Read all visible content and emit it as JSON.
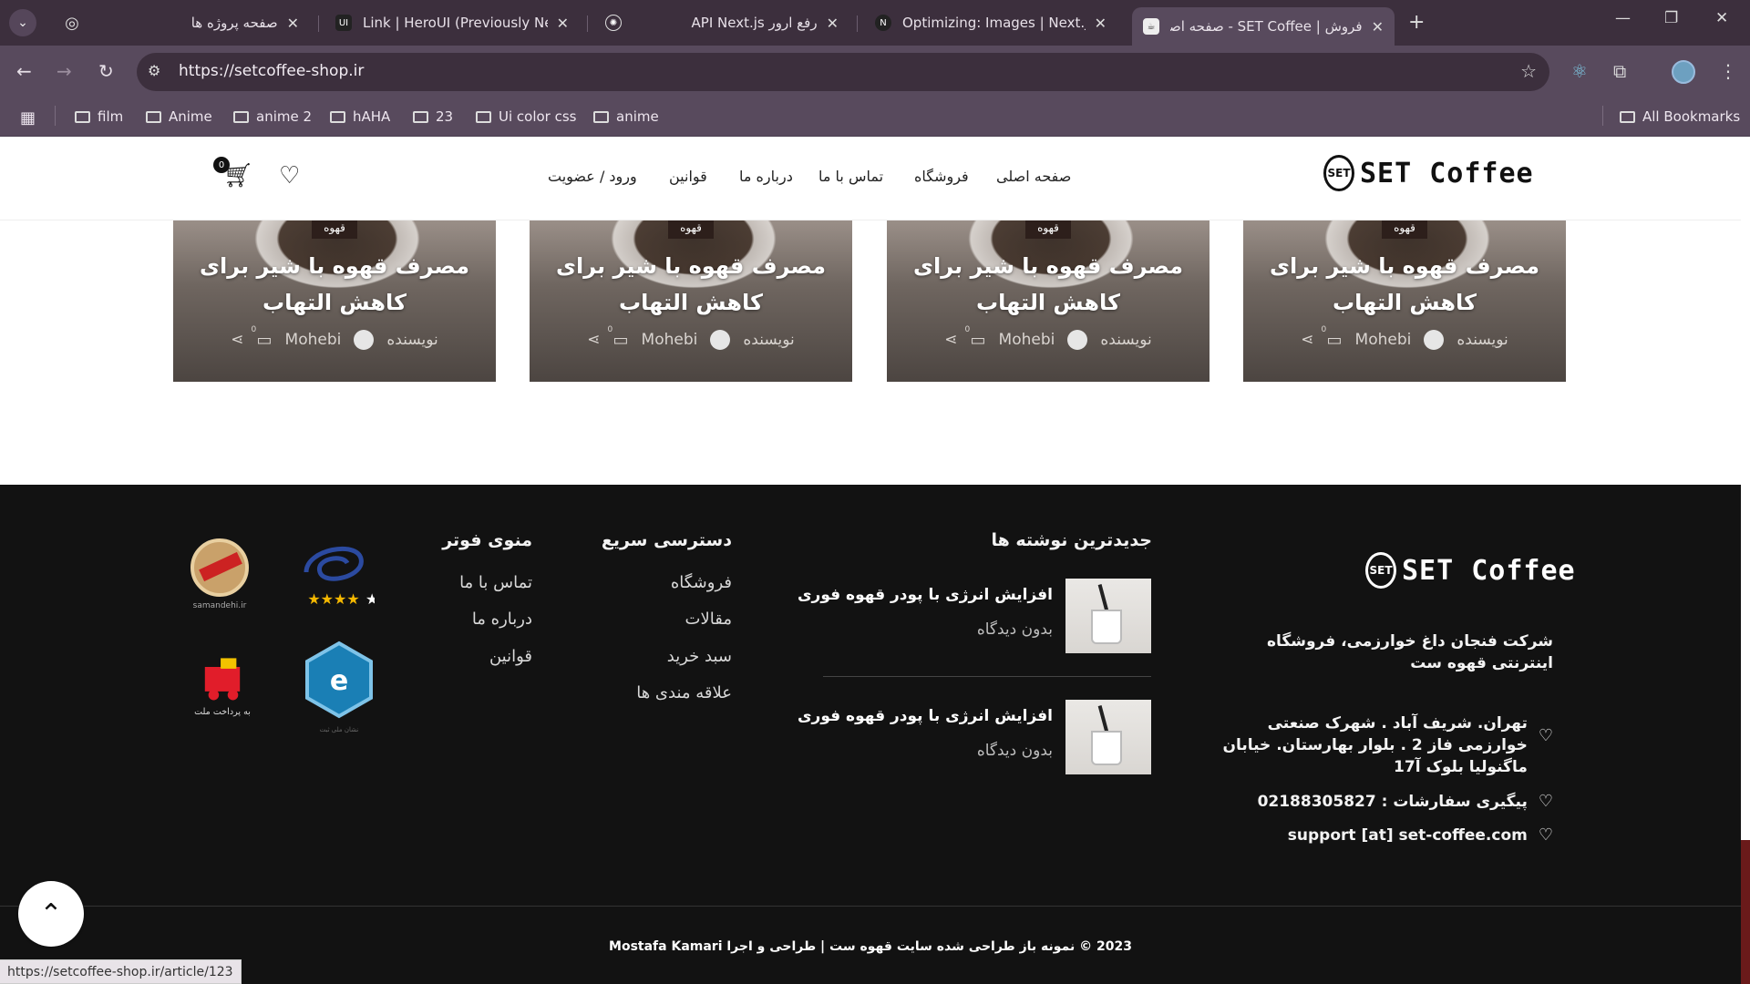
{
  "browser": {
    "tabs": [
      {
        "title": "صفحه پروژه ها",
        "icon": "globe-icon"
      },
      {
        "title": "Link | HeroUI (Previously NextUI)",
        "icon": "heroui-icon"
      },
      {
        "title": "رفع ارور API Next.js",
        "icon": "openai-icon"
      },
      {
        "title": "Optimizing: Images | Next.js",
        "icon": "nextjs-icon"
      },
      {
        "title": "فروش | SET Coffee - صفحه اصلی",
        "icon": "site-favicon"
      }
    ],
    "url": "https://setcoffee-shop.ir",
    "bookmarks": [
      "film",
      "Anime",
      "anime 2",
      "hAHA",
      "23",
      "Ui color css",
      "anime"
    ],
    "all_bookmarks": "All Bookmarks",
    "status_url": "https://setcoffee-shop.ir/article/123"
  },
  "header": {
    "logo_text": "SET Coffee",
    "logo_mark": "SET",
    "nav": [
      "صفحه اصلی",
      "فروشگاه",
      "تماس با ما",
      "درباره ما",
      "قوانین",
      "ورود / عضویت"
    ],
    "cart_count": "0"
  },
  "cards": [
    {
      "category": "قهوه",
      "title": "مصرف قهوه با شیر برای کاهش التهاب",
      "author_label": "نویسنده",
      "author": "Mohebi",
      "comments": "0"
    },
    {
      "category": "قهوه",
      "title": "مصرف قهوه با شیر برای کاهش التهاب",
      "author_label": "نویسنده",
      "author": "Mohebi",
      "comments": "0"
    },
    {
      "category": "قهوه",
      "title": "مصرف قهوه با شیر برای کاهش التهاب",
      "author_label": "نویسنده",
      "author": "Mohebi",
      "comments": "0"
    },
    {
      "category": "قهوه",
      "title": "مصرف قهوه با شیر برای کاهش التهاب",
      "author_label": "نویسنده",
      "author": "Mohebi",
      "comments": "0"
    }
  ],
  "footer": {
    "logo_text": "SET Coffee",
    "about": "شرکت فنجان داغ خوارزمی، فروشگاه اینترنتی قهوه ست",
    "address": "تهران. شریف آباد . شهرک صنعتی خوارزمی فاز 2 . بلوار بهارستان. خیابان ماگنولیا بلوک آ17",
    "phone": "پیگیری سفارشات : 02188305827",
    "email": "support [at] set-coffee.com",
    "latest_title": "جدیدترین نوشته ها",
    "posts": [
      {
        "title": "افزایش انرژی با پودر قهوه فوری",
        "views": "بدون دیدگاه"
      },
      {
        "title": "افزایش انرژی با پودر قهوه فوری",
        "views": "بدون دیدگاه"
      }
    ],
    "quick_title": "دسترسی سریع",
    "quick_links": [
      "فروشگاه",
      "مقالات",
      "سبد خرید",
      "علاقه مندی ها"
    ],
    "menu_title": "منوی فوتر",
    "menu_links": [
      "تماس با ما",
      "درباره ما",
      "قوانین"
    ],
    "copyright": "2023 © نمونه باز طراحی شده سایت قهوه ست | طراحی و اجرا Mostafa Kamari"
  }
}
